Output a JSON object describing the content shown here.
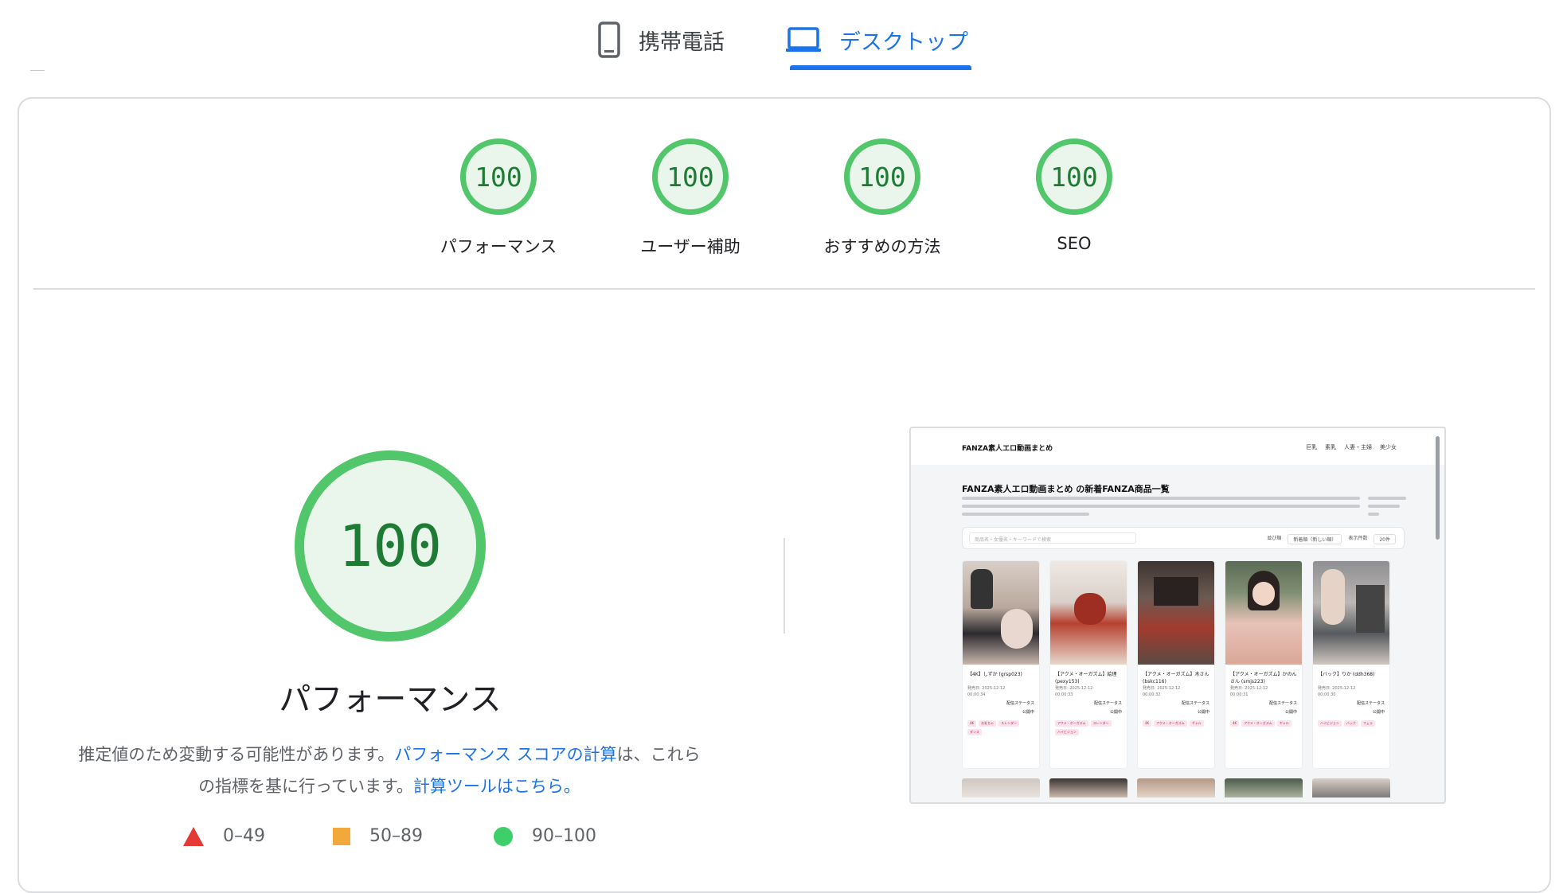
{
  "tabs": {
    "mobile_label": "携帯電話",
    "desktop_label": "デスクトップ",
    "active": "desktop"
  },
  "categories": [
    {
      "score": "100",
      "label": "パフォーマンス"
    },
    {
      "score": "100",
      "label": "ユーザー補助"
    },
    {
      "score": "100",
      "label": "おすすめの方法"
    },
    {
      "score": "100",
      "label": "SEO"
    }
  ],
  "performance": {
    "score": "100",
    "title": "パフォーマンス",
    "desc_part1": "推定値のため変動する可能性があります。",
    "desc_link1": "パフォーマンス スコアの計算",
    "desc_part2": "は、これらの指標を基に行っています。",
    "desc_link2": "計算ツールはこちら。"
  },
  "legend": {
    "fail": "0–49",
    "average": "50–89",
    "pass": "90–100"
  },
  "colors": {
    "accent": "#1a73e8",
    "pass": "#52c66a",
    "pass_bg": "#eaf6ec",
    "pass_text": "#1e7b34",
    "average": "#f2a83b",
    "fail": "#e53935"
  },
  "thumbnail": {
    "brand": "FANZA素人エロ動画まとめ",
    "nav": [
      "巨乳",
      "素乳",
      "人妻・主婦",
      "美少女"
    ],
    "page_title": "FANZA素人エロ動画まとめ の新着FANZA商品一覧",
    "search_placeholder": "商品名・女優名・キーワードで検索",
    "sort_label": "並び順",
    "sort_value": "新着順（新しい順）",
    "count_label": "表示件数",
    "count_value": "20件",
    "cards": [
      {
        "title": "【4K】しずか (grsp023)",
        "date": "発売日: 2025-12-12",
        "time": "00:00:34",
        "status_label": "配信ステータス",
        "status": "公開中",
        "tags": [
          "4K",
          "お乳ちゃ",
          "スレンダー",
          "ダンス"
        ]
      },
      {
        "title": "【アクメ・オーガズム】絵理 (pexy153)",
        "date": "発売日: 2025-12-12",
        "time": "00:00:33",
        "status_label": "配信ステータス",
        "status": "公開中",
        "tags": [
          "アクメ・オーガズム",
          "スレンダー",
          "ハイビジョン"
        ]
      },
      {
        "title": "【アクメ・オーガズム】木さん (bskc116)",
        "date": "発売日: 2025-12-12",
        "time": "00:00:32",
        "status_label": "配信ステータス",
        "status": "公開中",
        "tags": [
          "4K",
          "アクメ・オーガズム",
          "ギャル"
        ]
      },
      {
        "title": "【アクメ・オーガズム】かのんさん (smjs223)",
        "date": "発売日: 2025-12-12",
        "time": "00:00:31",
        "status_label": "配信ステータス",
        "status": "公開中",
        "tags": [
          "4K",
          "アクメ・オーガズム",
          "ギャル"
        ]
      },
      {
        "title": "【バック】りか (ddh368)",
        "date": "発売日: 2025-12-12",
        "time": "00:00:30",
        "status_label": "配信ステータス",
        "status": "公開中",
        "tags": [
          "ハイビジョン",
          "バック",
          "フェラ"
        ]
      }
    ]
  }
}
